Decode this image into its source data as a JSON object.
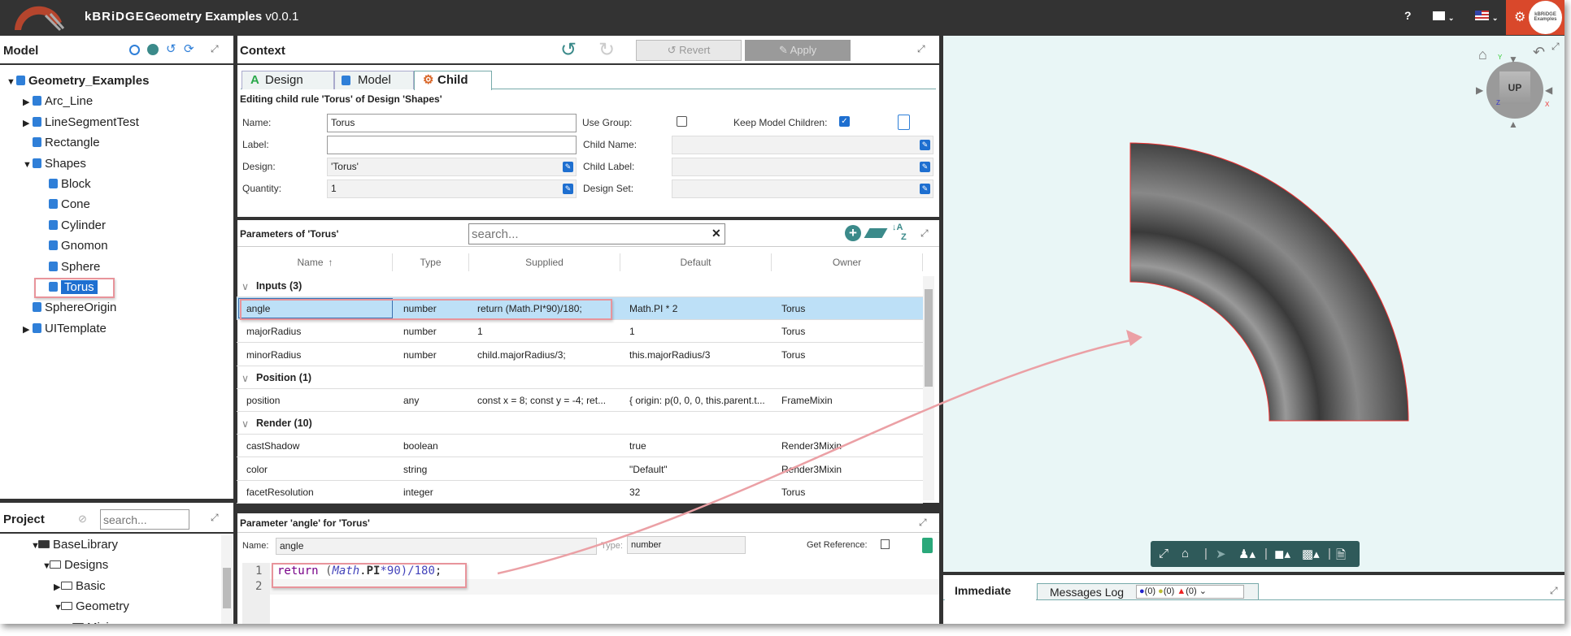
{
  "app": {
    "brand": "kBRiDGE",
    "title": "Geometry Examples",
    "version": "v0.0.1",
    "help_label": "?",
    "avatar_text": "kBRiDGE Examples"
  },
  "colors": {
    "topbar": "#333333",
    "accent": "#3b8a8a",
    "settings": "#d9482b",
    "selected_row": "#bde0f7",
    "viewer_bg": "#e9f6f6",
    "highlight": "#e8949b"
  },
  "model": {
    "title": "Model",
    "tree": [
      {
        "label": "Geometry_Examples",
        "level": 0,
        "expander": "open",
        "bold": true
      },
      {
        "label": "Arc_Line",
        "level": 1,
        "expander": "closed"
      },
      {
        "label": "LineSegmentTest",
        "level": 1,
        "expander": "closed"
      },
      {
        "label": "Rectangle",
        "level": 1,
        "expander": "none"
      },
      {
        "label": "Shapes",
        "level": 1,
        "expander": "open"
      },
      {
        "label": "Block",
        "level": 2,
        "expander": "none"
      },
      {
        "label": "Cone",
        "level": 2,
        "expander": "none"
      },
      {
        "label": "Cylinder",
        "level": 2,
        "expander": "none"
      },
      {
        "label": "Gnomon",
        "level": 2,
        "expander": "none"
      },
      {
        "label": "Sphere",
        "level": 2,
        "expander": "none"
      },
      {
        "label": "Torus",
        "level": 2,
        "expander": "none",
        "selected": true
      },
      {
        "label": "SphereOrigin",
        "level": 1,
        "expander": "none"
      },
      {
        "label": "UITemplate",
        "level": 1,
        "expander": "closed"
      }
    ]
  },
  "project": {
    "title": "Project",
    "search_placeholder": "search...",
    "tree": [
      {
        "label": "BaseLibrary",
        "level": 0,
        "expander": "open",
        "filled": true
      },
      {
        "label": "Designs",
        "level": 1,
        "expander": "open"
      },
      {
        "label": "Basic",
        "level": 2,
        "expander": "closed"
      },
      {
        "label": "Geometry",
        "level": 2,
        "expander": "open"
      },
      {
        "label": "Mixins",
        "level": 3,
        "expander": "closed"
      }
    ]
  },
  "context": {
    "title": "Context",
    "revert_label": "Revert",
    "apply_label": "Apply",
    "tabs": [
      {
        "label": "Design"
      },
      {
        "label": "Model"
      },
      {
        "label": "Child",
        "active": true
      }
    ],
    "editing_label": "Editing child rule 'Torus' of Design 'Shapes'",
    "form": {
      "name_label": "Name:",
      "name_value": "Torus",
      "label_label": "Label:",
      "label_value": "",
      "design_label": "Design:",
      "design_value": "'Torus'",
      "quantity_label": "Quantity:",
      "quantity_value": "1",
      "use_group_label": "Use Group:",
      "use_group_checked": false,
      "keep_children_label": "Keep Model Children:",
      "keep_children_checked": true,
      "child_name_label": "Child Name:",
      "child_label_label": "Child Label:",
      "design_set_label": "Design Set:"
    }
  },
  "parameters": {
    "title": "Parameters of 'Torus'",
    "search_placeholder": "search...",
    "columns": [
      "Name",
      "Type",
      "Supplied",
      "Default",
      "Owner"
    ],
    "rows": [
      {
        "group": "Inputs (3)"
      },
      {
        "name": "angle",
        "type": "number",
        "supplied": "return (Math.PI*90)/180;",
        "default": "Math.PI * 2",
        "owner": "Torus",
        "selected": true
      },
      {
        "name": "majorRadius",
        "type": "number",
        "supplied": "1",
        "default": "1",
        "owner": "Torus"
      },
      {
        "name": "minorRadius",
        "type": "number",
        "supplied": "child.majorRadius/3;",
        "default": "this.majorRadius/3",
        "owner": "Torus"
      },
      {
        "group": "Position (1)"
      },
      {
        "name": "position",
        "type": "any",
        "supplied": "const x = 8; const y = -4; ret...",
        "default": "{ origin: p(0, 0, 0, this.parent.t...",
        "owner": "FrameMixin"
      },
      {
        "group": "Render (10)"
      },
      {
        "name": "castShadow",
        "type": "boolean",
        "supplied": "",
        "default": "true",
        "owner": "Render3Mixin"
      },
      {
        "name": "color",
        "type": "string",
        "supplied": "",
        "default": "\"Default\"",
        "owner": "Render3Mixin"
      },
      {
        "name": "facetResolution",
        "type": "integer",
        "supplied": "",
        "default": "32",
        "owner": "Torus"
      }
    ]
  },
  "param_editor": {
    "title": "Parameter 'angle' for 'Torus'",
    "name_label": "Name:",
    "name_value": "angle",
    "type_label": "Type:",
    "type_value": "number",
    "get_reference_label": "Get Reference:",
    "code": {
      "line_numbers": [
        "1",
        "2"
      ],
      "keyword": "return",
      "open": " (",
      "obj": "Math",
      "dot": ".",
      "prop": "PI",
      "op": "*",
      "num": "90",
      "close": ")/180",
      "semi": ";"
    }
  },
  "viewer": {
    "navcube_label": "UP",
    "axes": [
      "Y",
      "Z",
      "X"
    ]
  },
  "bottom": {
    "tabs": [
      {
        "label": "Immediate",
        "active": true
      },
      {
        "label": "Messages Log"
      }
    ],
    "info_count": "(0)",
    "warn_count": "(0)",
    "error_count": "(0)"
  }
}
